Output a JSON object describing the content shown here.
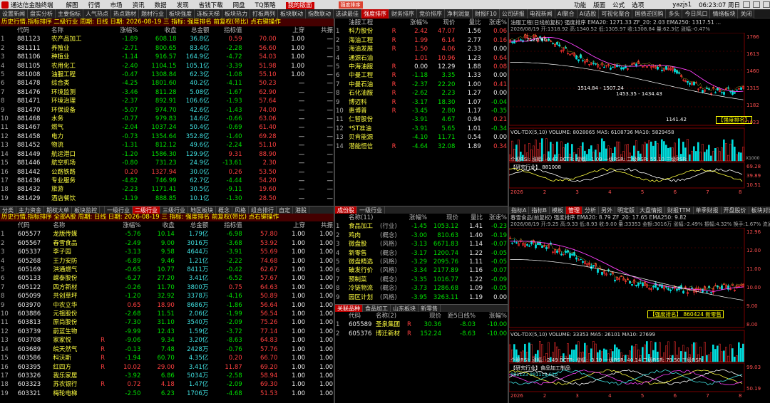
{
  "titlebar": {
    "app": "通达信金融终端",
    "menu": [
      "解图",
      "行情",
      "市场",
      "资讯",
      "数据",
      "发现",
      "省钱下载",
      "网盘",
      "TQ策略",
      "我的版面"
    ],
    "active_menu": "我的版面",
    "tag": "强度排序",
    "right": [
      "功能",
      "版面",
      "公式",
      "选项"
    ],
    "user": "yazjs1",
    "clock": "06:23:07 周日"
  },
  "funcbar": [
    "设置新闻",
    "盘实分析",
    "主要指标",
    "人气热点",
    "热点题材",
    "题材行业",
    "板块强度",
    "连板天梯",
    "板块热力",
    "打板两列",
    "板块联动",
    "指数联动",
    "选读最佳",
    "强度排序",
    "财务排序",
    "竞价排序",
    "净利润复",
    "财报F10",
    "公司研报",
    "电视新闻",
    "AI聚合",
    "AI选股",
    "可视化聚合",
    "国债逆回购",
    "多头",
    "今日风口",
    "情绪板块",
    "关闭"
  ],
  "funcbar_active": "强度排序",
  "panel1": {
    "title": "历史行情.指标排序 二级行业 周期: 日线 日期: 2026-08-19 三 指标: 强度排名 前复权(带比) 点右键操作",
    "headers": [
      "",
      "代码",
      "名称",
      "涨幅%",
      "收盘",
      "总金额",
      "指标值",
      "",
      "上穿",
      "共振"
    ],
    "rows": [
      [
        "1",
        "881123",
        "农产品加工",
        "-1.89",
        "608.18",
        "36.8亿",
        "0.59",
        "70.00",
        "1.00",
        "—"
      ],
      [
        "2",
        "881111",
        "养殖业",
        "-2.71",
        "800.65",
        "83.4亿",
        "-2.28",
        "56.60",
        "1.00",
        "—"
      ],
      [
        "3",
        "881106",
        "种植业",
        "-1.14",
        "916.57",
        "164.9亿",
        "-4.72",
        "54.03",
        "1.00",
        "—"
      ],
      [
        "4",
        "881105",
        "农用化工",
        "-2.40",
        "1104.15",
        "105.1亿",
        "-3.39",
        "51.98",
        "1.00",
        "—"
      ],
      [
        "5",
        "881008",
        "油服工程",
        "-0.47",
        "1308.84",
        "62.3亿",
        "-1.08",
        "55.10",
        "1.00",
        "—"
      ],
      [
        "6",
        "881478",
        "综合类",
        "-4.25",
        "1801.60",
        "40.2亿",
        "-4.11",
        "50.23",
        "—",
        "—"
      ],
      [
        "7",
        "881476",
        "环境监测",
        "-3.46",
        "811.28",
        "5.08亿",
        "-1.67",
        "62.90",
        "—",
        "—"
      ],
      [
        "8",
        "881471",
        "环境治理",
        "-2.37",
        "892.91",
        "106.6亿",
        "-1.93",
        "57.64",
        "—",
        "—"
      ],
      [
        "9",
        "881470",
        "环保设备",
        "-5.07",
        "974.70",
        "42.6亿",
        "-1.43",
        "74.00",
        "—",
        "—"
      ],
      [
        "10",
        "881468",
        "水务",
        "-0.77",
        "979.83",
        "14.6亿",
        "-0.66",
        "63.06",
        "—",
        "—"
      ],
      [
        "11",
        "881467",
        "燃气",
        "-2.04",
        "1037.24",
        "50.4亿",
        "-0.69",
        "61.40",
        "—",
        "—"
      ],
      [
        "12",
        "881458",
        "电力",
        "-0.73",
        "1354.64",
        "352.8亿",
        "-1.40",
        "69.28",
        "—",
        "—"
      ],
      [
        "13",
        "881452",
        "物流",
        "-1.31",
        "812.12",
        "49.6亿",
        "-2.24",
        "51.10",
        "—",
        "—"
      ],
      [
        "14",
        "881449",
        "航运港口",
        "-1.20",
        "1586.30",
        "129.9亿",
        "9.31",
        "88.90",
        "—",
        "—"
      ],
      [
        "15",
        "881446",
        "航空机场",
        "-0.80",
        "731.23",
        "24.9亿",
        "-13.61",
        "2.30",
        "—",
        "—"
      ],
      [
        "16",
        "881442",
        "公路铁路",
        "0.20",
        "1327.94",
        "30.0亿",
        "0.26",
        "53.50",
        "—",
        "—"
      ],
      [
        "17",
        "881436",
        "专业服务",
        "-4.82",
        "746.99",
        "62.7亿",
        "-4.44",
        "54.20",
        "—",
        "—"
      ],
      [
        "18",
        "881432",
        "旅游",
        "-2.23",
        "1171.41",
        "30.5亿",
        "-9.11",
        "19.60",
        "—",
        "—"
      ],
      [
        "19",
        "881429",
        "酒店餐饮",
        "-1.19",
        "888.85",
        "10.1亿",
        "-1.30",
        "28.50",
        "—",
        "—"
      ]
    ],
    "tabs": [
      "分类",
      "主力资金",
      "期权大单",
      "板块监控",
      "",
      "一级行业",
      "二级行业",
      "三级行业",
      "地区板块",
      "概念",
      "风格",
      "组合排行",
      "自定",
      "港股"
    ],
    "tabs_active": "二级行业"
  },
  "panel2": {
    "title": "历史行情.指标排序 全部A股 周期: 日线 日期: 2026-08-19 三 指标: 强度排名 前复权(带比) 点右键操作",
    "headers": [
      "",
      "代码",
      "名称",
      "",
      "涨幅%",
      "收盘",
      "总金额",
      "指标值",
      "",
      "上穿",
      "共振"
    ],
    "rows": [
      [
        "1",
        "605577",
        "龙版传媒",
        "",
        "-5.76",
        "10.14",
        "1.79亿",
        "-6.98",
        "57.80",
        "1.00",
        "1.00"
      ],
      [
        "2",
        "605567",
        "春雪食品",
        "",
        "-2.49",
        "9.00",
        "3016万",
        "-3.68",
        "53.92",
        "1.00",
        "1.00"
      ],
      [
        "3",
        "605337",
        "李子园",
        "",
        "-3.13",
        "9.58",
        "4644万",
        "-3.91",
        "55.69",
        "1.00",
        "1.00"
      ],
      [
        "4",
        "605268",
        "王力安防",
        "",
        "-6.89",
        "9.46",
        "1.21亿",
        "-2.22",
        "74.68",
        "1.00",
        "1.00"
      ],
      [
        "5",
        "605169",
        "洪通燃气",
        "",
        "-0.65",
        "10.77",
        "8411万",
        "-0.42",
        "62.67",
        "1.00",
        "1.00"
      ],
      [
        "6",
        "605133",
        "嵘泰股份",
        "",
        "-6.27",
        "27.20",
        "3.41亿",
        "-6.52",
        "57.67",
        "1.00",
        "1.00"
      ],
      [
        "7",
        "605122",
        "四方新材",
        "",
        "-0.26",
        "11.70",
        "3800万",
        "0.75",
        "64.63",
        "1.00",
        "1.00"
      ],
      [
        "8",
        "605099",
        "共创草坪",
        "",
        "-1.20",
        "32.92",
        "3378万",
        "-4.16",
        "50.89",
        "1.00",
        "1.00"
      ],
      [
        "9",
        "603970",
        "中农立华",
        "",
        "0.65",
        "18.90",
        "8686万",
        "-1.86",
        "56.64",
        "1.00",
        "1.00"
      ],
      [
        "10",
        "603886",
        "元祖股份",
        "",
        "-2.68",
        "11.51",
        "2.06亿",
        "-1.99",
        "56.54",
        "1.00",
        "1.00"
      ],
      [
        "11",
        "603813",
        "原尚股份",
        "",
        "-7.30",
        "31.10",
        "3540万",
        "-2.09",
        "75.26",
        "1.00",
        "1.00"
      ],
      [
        "12",
        "603739",
        "蔚蓝生物",
        "",
        "-9.99",
        "12.43",
        "1.59亿",
        "-3.72",
        "77.14",
        "1.00",
        "1.00"
      ],
      [
        "13",
        "603708",
        "家家悦",
        "R",
        "-9.06",
        "9.34",
        "3.20亿",
        "-8.63",
        "64.83",
        "1.00",
        "1.00"
      ],
      [
        "14",
        "603689",
        "皖天然气",
        "R",
        "-0.13",
        "7.48",
        "2428万",
        "-0.76",
        "57.76",
        "1.00",
        "1.00"
      ],
      [
        "15",
        "603586",
        "科沃斯",
        "R",
        "-1.94",
        "60.70",
        "4.35亿",
        "0.20",
        "66.70",
        "1.00",
        "1.00"
      ],
      [
        "16",
        "603395",
        "红四方",
        "R",
        "10.02",
        "29.00",
        "3.41亿",
        "11.87",
        "69.20",
        "1.00",
        "1.00"
      ],
      [
        "17",
        "603326",
        "我乐家居",
        "",
        "-3.92",
        "6.86",
        "5034万",
        "-2.58",
        "58.94",
        "1.00",
        "1.00"
      ],
      [
        "18",
        "603323",
        "苏农银行",
        "R",
        "0.72",
        "4.18",
        "1.47亿",
        "-2.09",
        "69.30",
        "1.00",
        "1.00"
      ],
      [
        "19",
        "603321",
        "梅轮电梯",
        "",
        "-2.50",
        "6.23",
        "1706万",
        "-4.68",
        "51.53",
        "1.00",
        "1.00"
      ]
    ]
  },
  "panel3": {
    "title": "油服工程(11)",
    "headers": [
      "",
      "油服工程",
      "",
      "涨幅%",
      "现价",
      "量比",
      "涨速%"
    ],
    "rows": [
      [
        "1",
        "科力股份",
        "R",
        "2.42",
        "47.07",
        "1.56",
        "0.06"
      ],
      [
        "2",
        "海油工程",
        "R",
        "1.99",
        "6.14",
        "2.77",
        "0.16"
      ],
      [
        "3",
        "海油发展",
        "R",
        "1.50",
        "4.06",
        "2.33",
        "0.00"
      ],
      [
        "4",
        "通源石油",
        "",
        "1.01",
        "10.96",
        "1.23",
        "0.64"
      ],
      [
        "5",
        "中海油服",
        "R",
        "0.00",
        "12.29",
        "1.88",
        "0.08"
      ],
      [
        "6",
        "中曼工程",
        "R",
        "-1.18",
        "3.35",
        "1.33",
        "0.00"
      ],
      [
        "7",
        "中曼石油",
        "R",
        "-2.37",
        "22.20",
        "1.00",
        "0.41"
      ],
      [
        "8",
        "石化油服",
        "R",
        "-2.62",
        "2.23",
        "1.27",
        "0.00"
      ],
      [
        "9",
        "博迈科",
        "R",
        "-3.17",
        "18.30",
        "1.07",
        "-0.04"
      ],
      [
        "10",
        "惠博普",
        "R",
        "-3.45",
        "2.80",
        "1.17",
        "-0.35"
      ],
      [
        "11",
        "仁智股份",
        "",
        "-3.91",
        "4.67",
        "0.94",
        "0.21"
      ],
      [
        "12",
        "*ST准油",
        "",
        "-3.91",
        "5.65",
        "1.01",
        "-0.34"
      ],
      [
        "13",
        "贝肯能源",
        "",
        "-4.10",
        "11.71",
        "0.54",
        "0.00"
      ],
      [
        "14",
        "潜能恒信",
        "R",
        "-4.64",
        "32.08",
        "1.89",
        "0.34"
      ]
    ],
    "tabs": [
      "成份股",
      "一级行业"
    ],
    "tabs_active": "成份股"
  },
  "panel4": {
    "headers": [
      "",
      "名称(11)",
      "",
      "涨幅%",
      "现价",
      "量比",
      "涨速%"
    ],
    "rows": [
      [
        "1",
        "食品加工",
        "(行业)",
        "-1.45",
        "1053.12",
        "1.41",
        "-0.23"
      ],
      [
        "2",
        "鸡肉",
        "(概念)",
        "-3.00",
        "810.63",
        "1.40",
        "-0.19"
      ],
      [
        "3",
        "微盘股",
        "(风格)",
        "-3.13",
        "6671.83",
        "1.14",
        "-0.07"
      ],
      [
        "4",
        "新零售",
        "(概念)",
        "-3.17",
        "1200.74",
        "1.22",
        "-0.05"
      ],
      [
        "5",
        "微盘精选",
        "(风格)",
        "-3.29",
        "2095.76",
        "1.11",
        "-0.05"
      ],
      [
        "6",
        "破发行价",
        "(风格)",
        "-3.34",
        "2177.89",
        "1.16",
        "-0.07"
      ],
      [
        "7",
        "预制菜",
        "(概念)",
        "-3.35",
        "1016.77",
        "1.22",
        "-0.09"
      ],
      [
        "8",
        "冷链物流",
        "(概念)",
        "-3.73",
        "1286.68",
        "1.09",
        "-0.05"
      ],
      [
        "9",
        "园区计划",
        "(风格)",
        "-3.95",
        "3263.11",
        "1.19",
        "0.00"
      ]
    ],
    "tabs": [
      "关联品种",
      "食品加工",
      "山东板块",
      "新零售"
    ],
    "tabs_active": "关联品种",
    "sub_headers": [
      "",
      "代码",
      "名称(2)",
      "",
      "现价",
      "距5日线%",
      "涨幅%"
    ],
    "sub_rows": [
      [
        "1",
        "605589",
        "圣泉集团",
        "R",
        "30.36",
        "-8.03",
        "-10.00"
      ],
      [
        "2",
        "605376",
        "博迁新材",
        "R",
        "152.24",
        "-8.63",
        "-10.00"
      ]
    ]
  },
  "chart1": {
    "head": "油服工程(日线前复权) 强度排序 EMA20: 1271.33 ZF_20: 2.03 EMA250: 1317.51 ...",
    "head2": "2026/08/19 开:1318.92 高:1340.52 低:1305.97 收:1308.84 量:62.3亿 涨幅:-0.47%",
    "top_label": "2120.90",
    "mid_label": "1514.84 - 1507.24",
    "mid2_label": "1453.35 - 1434.43",
    "low_label": "1141.42",
    "y_ticks": [
      "1766",
      "1613",
      "1460",
      "1315",
      "1182",
      "1023"
    ],
    "box": "【强度排名】",
    "vol_head": "VOL-TDX(5,10) VOLUME: 8028065 MA5: 6108736 MA10: 5829458",
    "vol_unit": "X1000",
    "ind_head": "个股RSI: 涨幅: -0.47 BCTR: 增幅: -1.09 一级RSR: 二级RSR: 55.10 三级RSR:",
    "ind_sub": "【研究行业】 881008",
    "ind_ticks": [
      "69.28",
      "39.89",
      "10.51"
    ],
    "dates": [
      "2026",
      "2",
      "3",
      "4",
      "5",
      "6",
      "7",
      "8"
    ]
  },
  "chart2": {
    "tabs": [
      "指标A",
      "指标B",
      "模板",
      "管理",
      "分析",
      "另外",
      "明定版",
      "大盘情报",
      "财报TTM",
      "单季财报",
      "开盘股价",
      "板块对比",
      "行业对比"
    ],
    "tabs_active": "管理",
    "head": "春雪食品(前复权) 强度排序 EMA20: 8.79 ZF_20: 17.65 EMA250: 9.82",
    "head2": "2026/08/19 开:9.25 高:9.33 低:8.93 收:9.00 量:33353 金额:3016万 涨幅:-2.49% 振幅:4.32% 换手:1.67% 流通:2.00亿",
    "y_ticks": [
      "12.96",
      "12.00",
      "11.00",
      "10.00",
      "9.00",
      "8.00"
    ],
    "box": "【强度排名】",
    "box_tail": "860424 新零售",
    "vol_head": "VOL-TDX(5,10) VOLUME: 33353 MA5: 26101 MA10: 27699",
    "ind_head": "个股RSI: 涨幅: -2.49 BCTR: 增幅: -3.19 一级RSR: 40.14 二级RSR: 79.50 三级RSR:",
    "ind_sub": "【研究行业】食品加工制品",
    "ind_line2": "881123 881118 S10",
    "ind_ticks": [
      "99.03",
      "50.19"
    ],
    "dates": [
      "2026",
      "2",
      "3",
      "4",
      "5",
      "6",
      "7",
      "8"
    ]
  }
}
